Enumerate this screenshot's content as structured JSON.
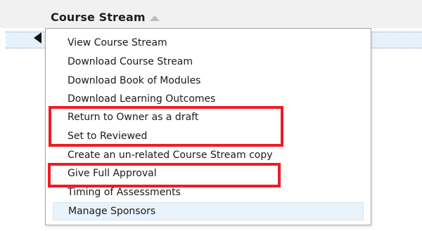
{
  "grid": {
    "column_header": {
      "title": "Course Stream",
      "sort_icon": "sort-ascending-icon"
    }
  },
  "context_menu": {
    "items": [
      {
        "id": "view-course-stream",
        "label": "View Course Stream"
      },
      {
        "id": "download-course-stream",
        "label": "Download Course Stream"
      },
      {
        "id": "download-book-of-modules",
        "label": "Download Book of Modules"
      },
      {
        "id": "download-learning-outcomes",
        "label": "Download Learning Outcomes"
      },
      {
        "id": "return-to-owner-as-draft",
        "label": "Return to Owner as a draft"
      },
      {
        "id": "set-to-reviewed",
        "label": "Set to Reviewed"
      },
      {
        "id": "create-unrelated-copy",
        "label": "Create an un-related Course Stream copy"
      },
      {
        "id": "give-full-approval",
        "label": "Give Full Approval"
      },
      {
        "id": "timing-of-assessments",
        "label": "Timing of Assessments"
      },
      {
        "id": "manage-sponsors",
        "label": "Manage Sponsors",
        "hovered": true
      }
    ]
  },
  "annotations": {
    "highlight_color": "#ee1c25"
  }
}
